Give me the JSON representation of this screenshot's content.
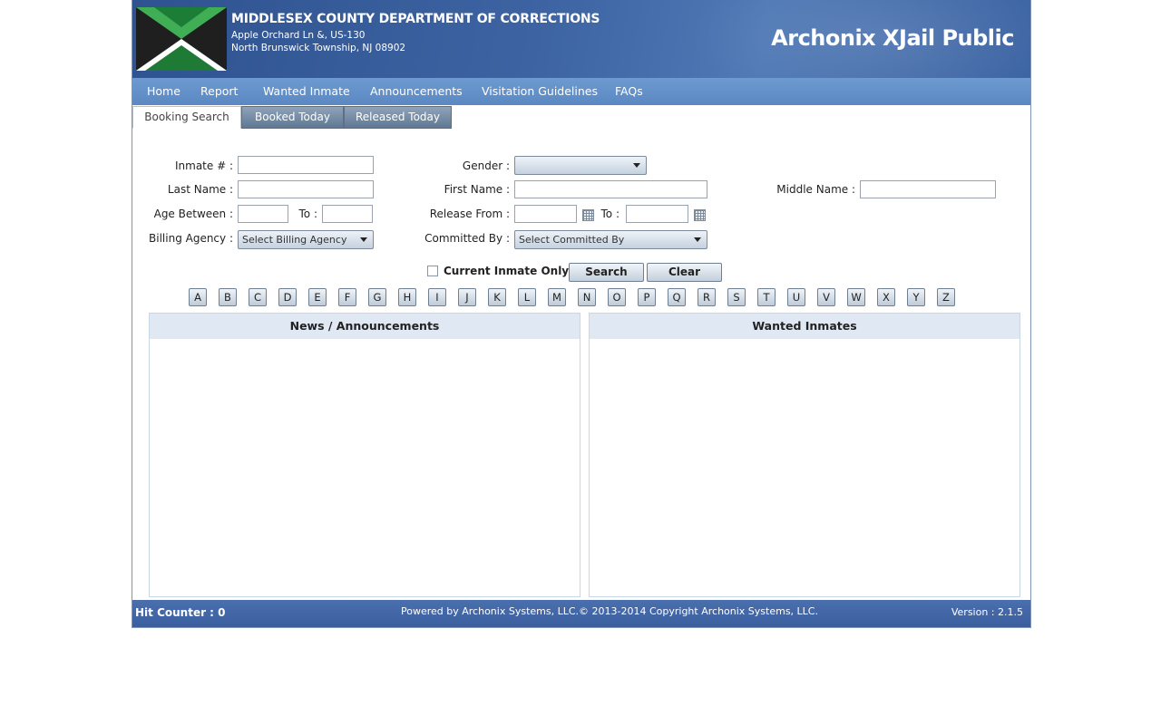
{
  "header": {
    "org_title": "MIDDLESEX COUNTY DEPARTMENT OF CORRECTIONS",
    "address_line1": "Apple Orchard Ln &, US-130",
    "address_line2": "North Brunswick Township, NJ 08902",
    "brand": "Archonix XJail Public",
    "logo": "county-logo"
  },
  "menu": {
    "items": [
      "Home",
      "Report",
      "Wanted Inmate",
      "Announcements",
      "Visitation Guidelines",
      "FAQs"
    ]
  },
  "tabs": [
    "Booking Search",
    "Booked Today",
    "Released Today"
  ],
  "form": {
    "inmate_label": "Inmate # :",
    "inmate_value": "",
    "last_name_label": "Last Name :",
    "last_name_value": "",
    "age_label": "Age Between :",
    "age_from_value": "",
    "age_to_label": "To :",
    "age_to_value": "",
    "billing_label": "Billing Agency :",
    "billing_selected": "Select Billing Agency",
    "gender_label": "Gender :",
    "gender_selected": "",
    "first_name_label": "First Name :",
    "first_name_value": "",
    "release_from_label": "Release From :",
    "release_from_value": "",
    "release_to_label": "To :",
    "release_to_value": "",
    "committed_label": "Committed By :",
    "committed_selected": "Select Committed By",
    "middle_name_label": "Middle Name :",
    "middle_name_value": "",
    "current_only_label": "Current Inmate Only",
    "current_only_checked": false,
    "search_label": "Search",
    "clear_label": "Clear"
  },
  "alphabet": [
    "A",
    "B",
    "C",
    "D",
    "E",
    "F",
    "G",
    "H",
    "I",
    "J",
    "K",
    "L",
    "M",
    "N",
    "O",
    "P",
    "Q",
    "R",
    "S",
    "T",
    "U",
    "V",
    "W",
    "X",
    "Y",
    "Z"
  ],
  "panels": {
    "news_title": "News / Announcements",
    "wanted_title": "Wanted Inmates"
  },
  "footer": {
    "hit_counter": "Hit Counter : 0",
    "powered": "Powered by Archonix Systems, LLC.© 2013-2014 Copyright Archonix Systems, LLC.",
    "version": "Version : 2.1.5"
  }
}
